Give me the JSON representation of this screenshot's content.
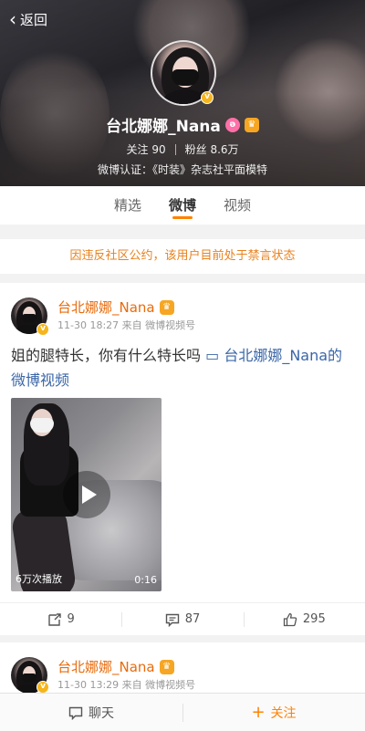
{
  "header": {
    "back_label": "返回",
    "name": "台北娜娜_Nana",
    "follow_label": "关注",
    "follow_count": "90",
    "fans_label": "粉丝",
    "fans_count": "8.6万",
    "verification": "微博认证：《时装》杂志社平面模特"
  },
  "tabs": [
    "精选",
    "微博",
    "视频"
  ],
  "active_tab": "微博",
  "notice": "因违反社区公约，该用户目前处于禁言状态",
  "posts": [
    {
      "author": "台北娜娜_Nana",
      "meta": "11-30 18:27 来自 微博视频号",
      "text": "姐的腿特长，你有什么特长吗 ",
      "link_text": "台北娜娜_Nana的微博视频",
      "video_plays": "6万次播放",
      "video_duration": "0:16",
      "reposts": "9",
      "comments": "87",
      "likes": "295"
    },
    {
      "author": "台北娜娜_Nana",
      "meta": "11-30 13:29 来自 微博视频号"
    }
  ],
  "bottom_bar": {
    "chat_label": "聊天",
    "follow_label": "关注"
  },
  "colors": {
    "accent": "#ff8200",
    "name_orange": "#e86b0c",
    "link_blue": "#3a66a7",
    "verified_gold": "#f6b51a"
  }
}
